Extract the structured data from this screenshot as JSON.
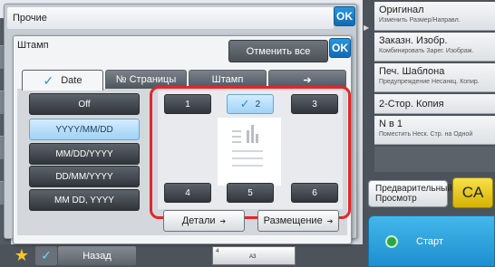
{
  "outer_dialog": {
    "title": "Прочие",
    "ok_label": "OK"
  },
  "inner_dialog": {
    "title": "Штамп",
    "ok_label": "OK",
    "cancel_all_label": "Отменить все"
  },
  "tabs": [
    {
      "label": "Date",
      "active": true
    },
    {
      "label": "№ Страницы",
      "active": false
    },
    {
      "label": "Штамп",
      "active": false
    },
    {
      "label": "➔",
      "active": false
    }
  ],
  "date_formats": [
    {
      "label": "Off",
      "selected": false
    },
    {
      "label": "YYYY/MM/DD",
      "selected": true
    },
    {
      "label": "MM/DD/YYYY",
      "selected": false
    },
    {
      "label": "DD/MM/YYYY",
      "selected": false
    },
    {
      "label": "MM DD, YYYY",
      "selected": false
    }
  ],
  "positions": [
    {
      "label": "1",
      "selected": false
    },
    {
      "label": "2",
      "selected": true
    },
    {
      "label": "3",
      "selected": false
    },
    {
      "label": "4",
      "selected": false
    },
    {
      "label": "5",
      "selected": false
    },
    {
      "label": "6",
      "selected": false
    }
  ],
  "actions": {
    "details_label": "Детали",
    "placement_label": "Размещение"
  },
  "right_panel": {
    "items": [
      {
        "title": "Оригинал",
        "sub": "Изменить Размер/Направл."
      },
      {
        "title": "Заказн. Изобр.",
        "sub": "Комбинировать Зарег. Изображ."
      },
      {
        "title": "Печ. Шаблона",
        "sub": "Предупреждение Несанкц. Копир."
      },
      {
        "title": "2-Стор. Копия",
        "sub": ""
      },
      {
        "title": "N в 1",
        "sub": "Поместить Неск. Стр. на Одной"
      }
    ],
    "preview_label": "Предварительный Просмотр",
    "ca_label": "CA",
    "start_label": "Старт"
  },
  "bottom_bar": {
    "back_label": "Назад",
    "paper_size": "A3",
    "paper_count": "4"
  },
  "colors": {
    "accent_blue": "#1e8fd0",
    "highlight_red": "#e02828",
    "ca_yellow": "#f8e04a",
    "selected_light_blue": "#b3dcf8"
  }
}
